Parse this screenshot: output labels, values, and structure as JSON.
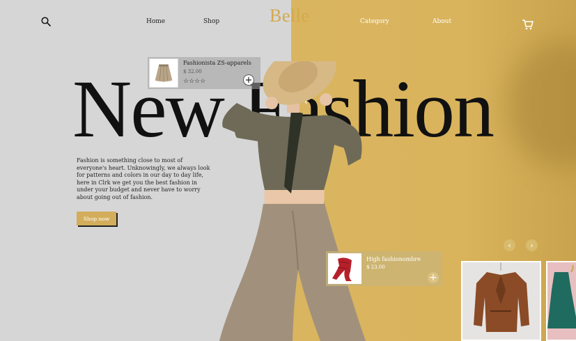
{
  "brand": {
    "name": "Belle",
    "color": "#d3a94c"
  },
  "nav": {
    "home": "Home",
    "shop": "Shop",
    "category": "Category",
    "about": "About",
    "search_icon": "search-icon",
    "cart_icon": "cart-icon"
  },
  "hero": {
    "title": "New Fashion",
    "description": "Fashion is something close to most of everyone's heart. Unknowingly, we always look for patterns and colors in our day to day life, here in Clrk we get you the best fashion in under your budget and never have to worry about going out of fashion.",
    "cta": "Shop now"
  },
  "products": [
    {
      "name": "Fashionista ZS-apparels",
      "price": "$ 32.00",
      "stars": "☆☆☆☆",
      "add": "+"
    },
    {
      "name": "High fashionombre",
      "price": "$ 23.00",
      "add": "+"
    }
  ],
  "carousel": {
    "prev": "‹",
    "next": "›"
  },
  "colors": {
    "accent": "#d3ad5b",
    "left_bg": "#d6d6d6",
    "right_bg": "#dab560"
  }
}
